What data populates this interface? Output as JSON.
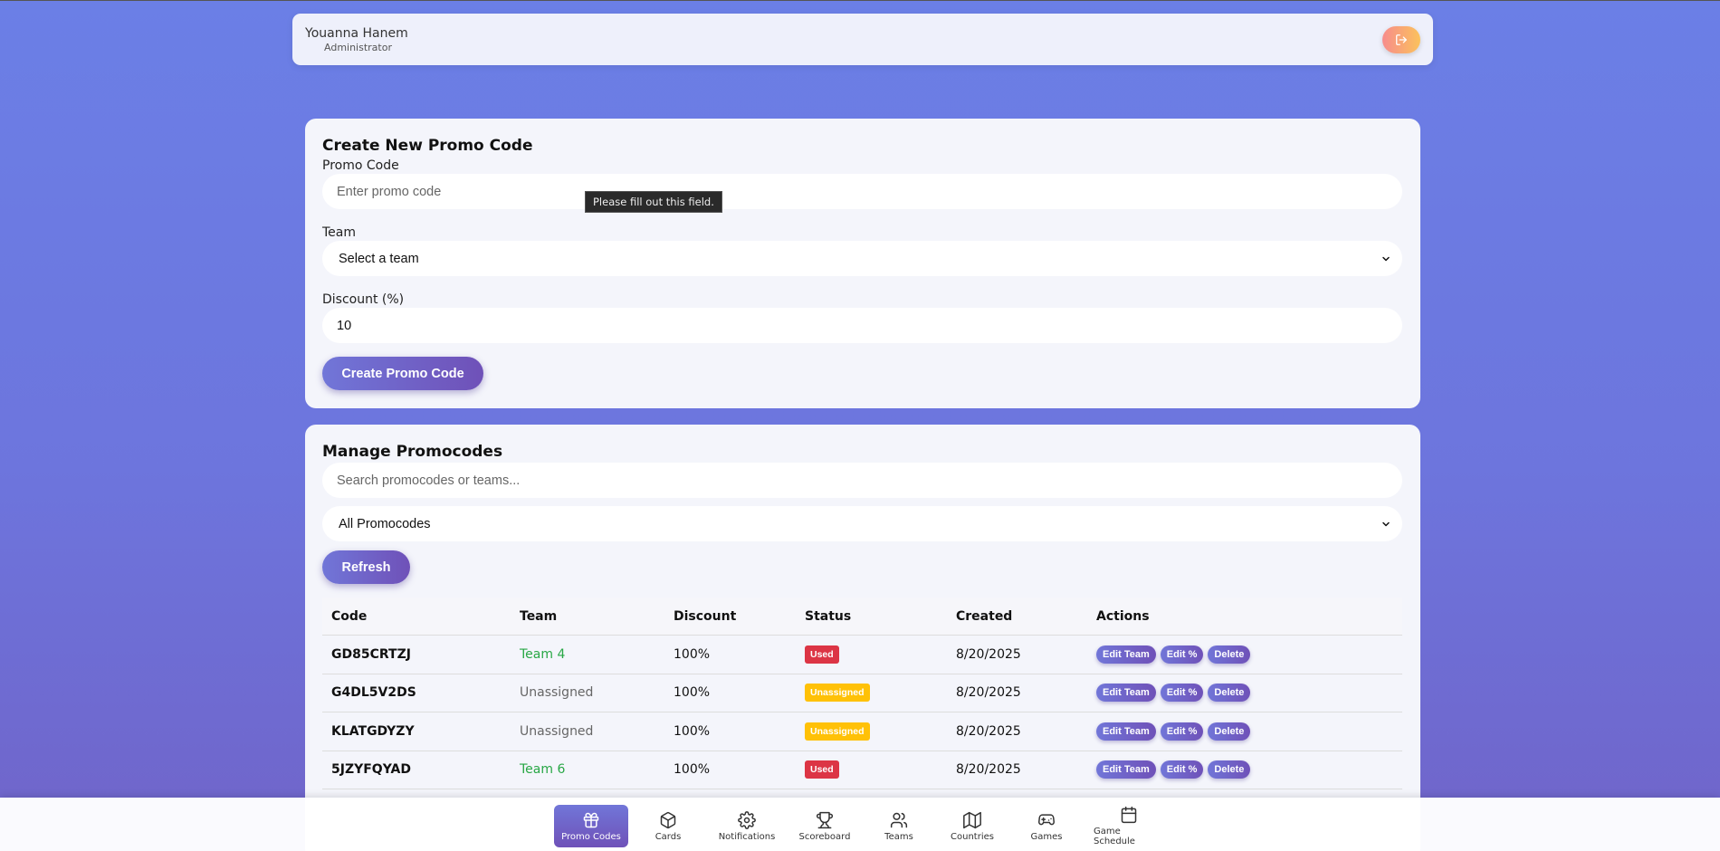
{
  "header": {
    "user_name": "Youanna Hanem",
    "user_role": "Administrator",
    "logout_icon": "logout-icon"
  },
  "create": {
    "title": "Create New Promo Code",
    "promo_label": "Promo Code",
    "promo_placeholder": "Enter promo code",
    "tooltip": "Please fill out this field.",
    "team_label": "Team",
    "team_selected": "Select a team",
    "discount_label": "Discount (%)",
    "discount_value": "10",
    "submit_label": "Create Promo Code"
  },
  "manage": {
    "title": "Manage Promocodes",
    "search_placeholder": "Search promocodes or teams...",
    "filter_selected": "All Promocodes",
    "refresh_label": "Refresh",
    "columns": [
      "Code",
      "Team",
      "Discount",
      "Status",
      "Created",
      "Actions"
    ],
    "rows": [
      {
        "code": "GD85CRTZJ",
        "team": "Team 4",
        "discount": "100%",
        "status": "Used",
        "created": "8/20/2025"
      },
      {
        "code": "G4DL5V2DS",
        "team": "Unassigned",
        "discount": "100%",
        "status": "Unassigned",
        "created": "8/20/2025"
      },
      {
        "code": "KLATGDYZY",
        "team": "Unassigned",
        "discount": "100%",
        "status": "Unassigned",
        "created": "8/20/2025"
      },
      {
        "code": "5JZYFQYAD",
        "team": "Team 6",
        "discount": "100%",
        "status": "Used",
        "created": "8/20/2025"
      }
    ],
    "actions": {
      "edit_team": "Edit Team",
      "edit_percent": "Edit %",
      "delete": "Delete"
    }
  },
  "nav": {
    "items": [
      {
        "label": "Promo Codes",
        "icon": "gift-icon",
        "active": true
      },
      {
        "label": "Cards",
        "icon": "box-icon"
      },
      {
        "label": "Notifications",
        "icon": "gear-icon"
      },
      {
        "label": "Scoreboard",
        "icon": "trophy-icon"
      },
      {
        "label": "Teams",
        "icon": "users-icon"
      },
      {
        "label": "Countries",
        "icon": "map-icon"
      },
      {
        "label": "Games",
        "icon": "gamepad-icon"
      },
      {
        "label": "Game Schedule",
        "icon": "calendar-icon"
      }
    ]
  },
  "colors": {
    "accent": "#6f51b8",
    "used": "#dc3545",
    "unassigned": "#ffc107",
    "assigned_team": "#28a745"
  }
}
